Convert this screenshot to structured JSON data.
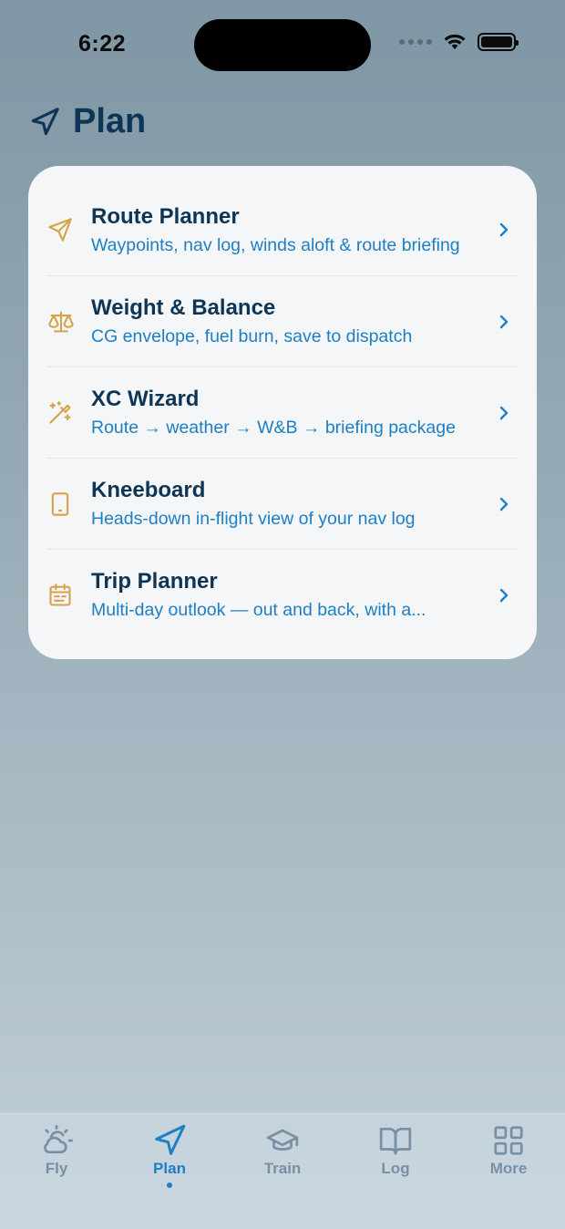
{
  "status": {
    "time": "6:22"
  },
  "header": {
    "title": "Plan",
    "icon": "navigation-arrow-icon"
  },
  "items": [
    {
      "title": "Route Planner",
      "subtitle": "Waypoints, nav log, winds aloft & route briefing",
      "icon": "send-arrow-icon"
    },
    {
      "title": "Weight & Balance",
      "subtitle": "CG envelope, fuel burn, save to dispatch",
      "icon": "scale-icon"
    },
    {
      "title": "XC Wizard",
      "subtitle": "Route → weather → W&B → briefing package",
      "icon": "magic-wand-icon"
    },
    {
      "title": "Kneeboard",
      "subtitle": "Heads-down in-flight view of your nav log",
      "icon": "tablet-icon"
    },
    {
      "title": "Trip Planner",
      "subtitle": "Multi-day outlook — out and back, with a...",
      "icon": "calendar-icon"
    }
  ],
  "tabs": [
    {
      "label": "Fly",
      "icon": "cloud-sun-icon"
    },
    {
      "label": "Plan",
      "icon": "navigation-arrow-icon",
      "active": true
    },
    {
      "label": "Train",
      "icon": "graduation-cap-icon"
    },
    {
      "label": "Log",
      "icon": "book-icon"
    },
    {
      "label": "More",
      "icon": "grid-icon"
    }
  ],
  "colors": {
    "accent": "#1d7fc4",
    "icon_gold": "#d8a24a",
    "title": "#0f3556",
    "inactive_tab": "#7790a3"
  }
}
